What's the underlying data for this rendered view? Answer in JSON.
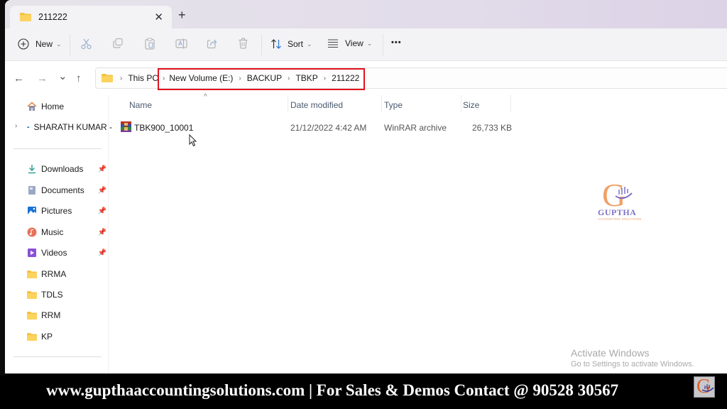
{
  "window": {
    "tab_title": "211222",
    "close_symbol": "✕",
    "new_tab_symbol": "+"
  },
  "toolbar": {
    "new_label": "New",
    "sort_label": "Sort",
    "view_label": "View",
    "more_label": "•••",
    "icons": [
      "cut-icon",
      "copy-icon",
      "paste-icon",
      "rename-icon",
      "share-icon",
      "delete-icon"
    ]
  },
  "navigation": {
    "back": "←",
    "forward": "→",
    "recent": "⌄",
    "up": "↑"
  },
  "address_bar": {
    "crumbs": [
      "This PC",
      "New Volume (E:)",
      "BACKUP",
      "TBKP",
      "211222"
    ],
    "separator": "›",
    "highlight_color": "#e0141e"
  },
  "sidebar": {
    "top_items": [
      {
        "label": "Home",
        "icon": "home-icon"
      },
      {
        "label": "SHARATH KUMAR -",
        "icon": "onedrive-cloud-icon",
        "expandable": true
      }
    ],
    "pinned_items": [
      {
        "label": "Downloads",
        "icon": "downloads-icon",
        "pinned": true
      },
      {
        "label": "Documents",
        "icon": "documents-icon",
        "pinned": true
      },
      {
        "label": "Pictures",
        "icon": "pictures-icon",
        "pinned": true
      },
      {
        "label": "Music",
        "icon": "music-icon",
        "pinned": true
      },
      {
        "label": "Videos",
        "icon": "videos-icon",
        "pinned": true
      }
    ],
    "folder_items": [
      {
        "label": "RRMA",
        "icon": "folder-icon"
      },
      {
        "label": "TDLS",
        "icon": "folder-icon"
      },
      {
        "label": "RRM",
        "icon": "folder-icon"
      },
      {
        "label": "KP",
        "icon": "folder-icon"
      }
    ]
  },
  "file_list": {
    "columns": [
      "Name",
      "Date modified",
      "Type",
      "Size"
    ],
    "sort_indicator": "^",
    "rows": [
      {
        "name": "TBK900_10001",
        "date_modified": "21/12/2022 4:42 AM",
        "type": "WinRAR archive",
        "size": "26,733 KB",
        "icon": "winrar-archive-icon"
      }
    ]
  },
  "watermark_logo": {
    "letter": "G",
    "name": "GUPTHA",
    "subtitle": "ACCOUNTING SOLUTIONS"
  },
  "activation_notice": {
    "title": "Activate Windows",
    "message": "Go to Settings to activate Windows."
  },
  "banner": {
    "text": "www.gupthaaccountingsolutions.com | For Sales & Demos Contact @ 90528 30567"
  }
}
